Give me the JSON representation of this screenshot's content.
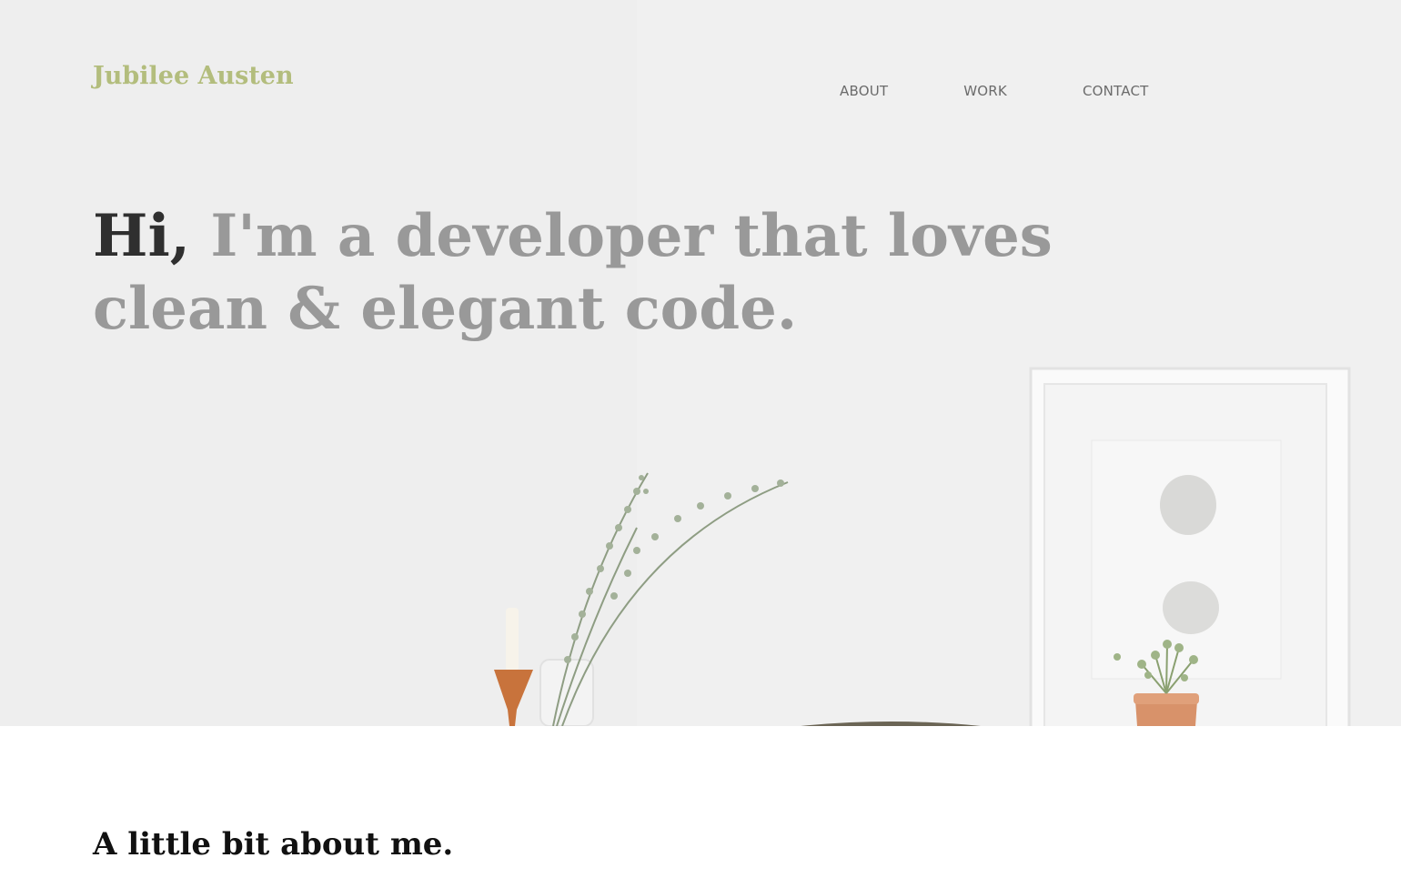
{
  "header": {
    "logo_text": "Jubilee Austen",
    "nav": [
      {
        "label": "ABOUT"
      },
      {
        "label": "WORK"
      },
      {
        "label": "CONTACT"
      }
    ]
  },
  "hero": {
    "greeting": "Hi,",
    "tagline": " I'm a developer that loves clean & elegant code."
  },
  "about": {
    "title": "A little bit about me."
  },
  "colors": {
    "logo": "#b3bd7d",
    "headline_muted": "#999999",
    "headline_dark": "#2f2f2f",
    "nav": "#6b6b6b"
  }
}
